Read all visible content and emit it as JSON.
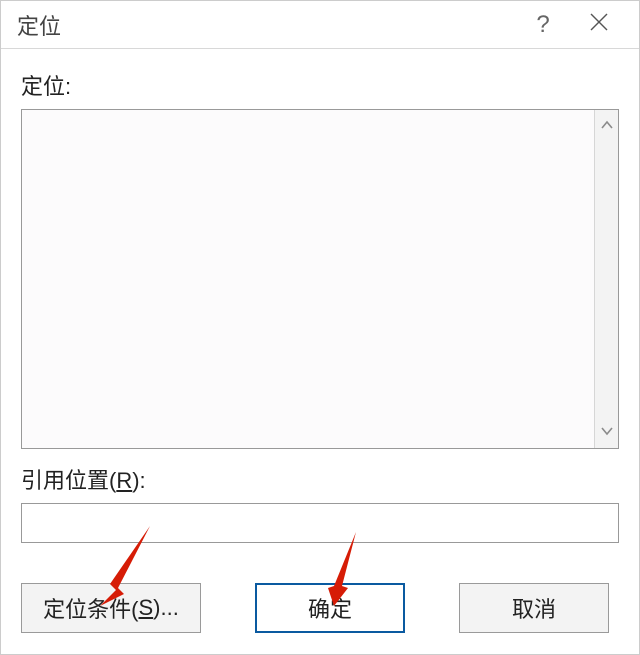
{
  "title": "定位",
  "labels": {
    "goto": "定位:",
    "reference_prefix": "引用位置(",
    "reference_hotkey": "R",
    "reference_suffix": "):"
  },
  "listbox": {
    "value": ""
  },
  "reference": {
    "value": ""
  },
  "buttons": {
    "special_prefix": "定位条件(",
    "special_hotkey": "S",
    "special_suffix": ")...",
    "ok": "确定",
    "cancel": "取消"
  },
  "arrows": {
    "color": "#d61c06"
  }
}
